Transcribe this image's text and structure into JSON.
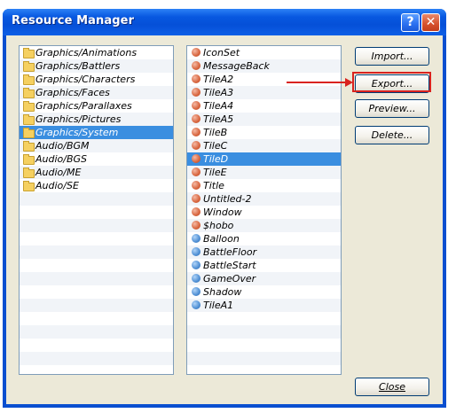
{
  "window": {
    "title": "Resource Manager",
    "help_label": "?",
    "close_label": "✕"
  },
  "folders": [
    {
      "label": "Graphics/Animations",
      "selected": false
    },
    {
      "label": "Graphics/Battlers",
      "selected": false
    },
    {
      "label": "Graphics/Characters",
      "selected": false
    },
    {
      "label": "Graphics/Faces",
      "selected": false
    },
    {
      "label": "Graphics/Parallaxes",
      "selected": false
    },
    {
      "label": "Graphics/Pictures",
      "selected": false
    },
    {
      "label": "Graphics/System",
      "selected": true
    },
    {
      "label": "Audio/BGM",
      "selected": false
    },
    {
      "label": "Audio/BGS",
      "selected": false
    },
    {
      "label": "Audio/ME",
      "selected": false
    },
    {
      "label": "Audio/SE",
      "selected": false
    }
  ],
  "files": [
    {
      "label": "IconSet",
      "icon": "red",
      "selected": false
    },
    {
      "label": "MessageBack",
      "icon": "red",
      "selected": false
    },
    {
      "label": "TileA2",
      "icon": "red",
      "selected": false
    },
    {
      "label": "TileA3",
      "icon": "red",
      "selected": false
    },
    {
      "label": "TileA4",
      "icon": "red",
      "selected": false
    },
    {
      "label": "TileA5",
      "icon": "red",
      "selected": false
    },
    {
      "label": "TileB",
      "icon": "red",
      "selected": false
    },
    {
      "label": "TileC",
      "icon": "red",
      "selected": false
    },
    {
      "label": "TileD",
      "icon": "red",
      "selected": true
    },
    {
      "label": "TileE",
      "icon": "red",
      "selected": false
    },
    {
      "label": "Title",
      "icon": "red",
      "selected": false
    },
    {
      "label": "Untitled-2",
      "icon": "red",
      "selected": false
    },
    {
      "label": "Window",
      "icon": "red",
      "selected": false
    },
    {
      "label": "$hobo",
      "icon": "red",
      "selected": false
    },
    {
      "label": "Balloon",
      "icon": "blue",
      "selected": false
    },
    {
      "label": "BattleFloor",
      "icon": "blue",
      "selected": false
    },
    {
      "label": "BattleStart",
      "icon": "blue",
      "selected": false
    },
    {
      "label": "GameOver",
      "icon": "blue",
      "selected": false
    },
    {
      "label": "Shadow",
      "icon": "blue",
      "selected": false
    },
    {
      "label": "TileA1",
      "icon": "blue",
      "selected": false
    }
  ],
  "buttons": {
    "import": "Import...",
    "export": "Export...",
    "preview": "Preview...",
    "delete": "Delete...",
    "close": "Close"
  },
  "colors": {
    "title_bar": "#0a4fd0",
    "selection": "#3a8ee0",
    "annotation": "#d9231f"
  }
}
